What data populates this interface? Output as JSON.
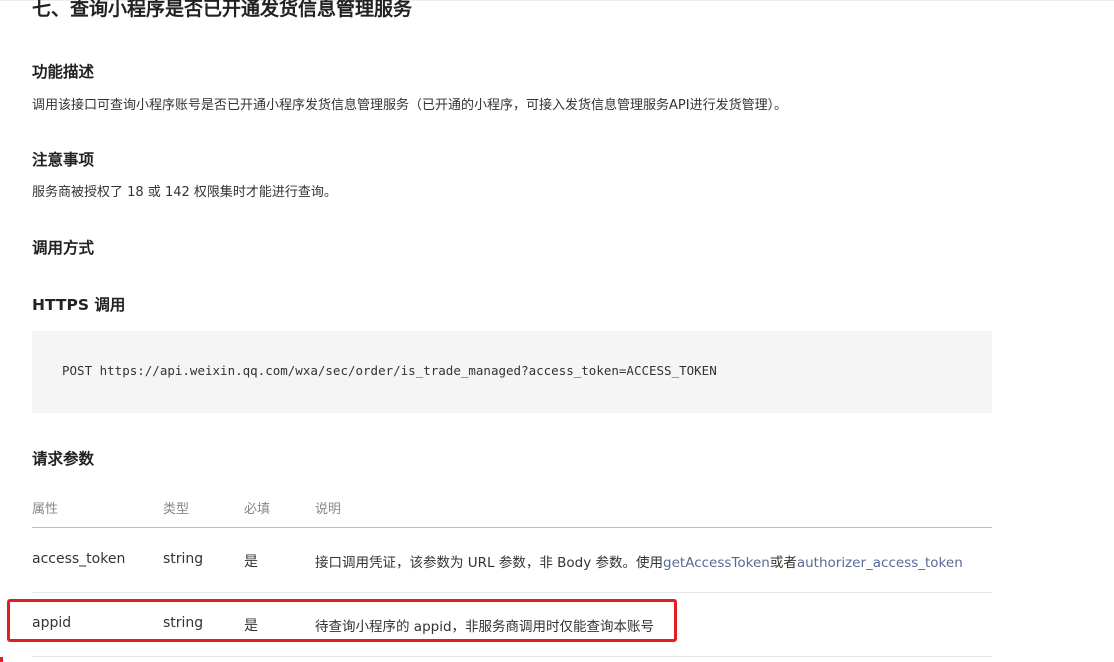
{
  "section_title": "七、查询小程序是否已开通发货信息管理服务",
  "function_desc": {
    "heading": "功能描述",
    "text": "调用该接口可查询小程序账号是否已开通小程序发货信息管理服务（已开通的小程序，可接入发货信息管理服务API进行发货管理）。"
  },
  "notes": {
    "heading": "注意事项",
    "text": "服务商被授权了 18 或 142 权限集时才能进行查询。"
  },
  "call_method": {
    "heading": "调用方式"
  },
  "https_call": {
    "heading": "HTTPS 调用",
    "code": "POST https://api.weixin.qq.com/wxa/sec/order/is_trade_managed?access_token=ACCESS_TOKEN"
  },
  "request_params": {
    "heading": "请求参数",
    "columns": [
      "属性",
      "类型",
      "必填",
      "说明"
    ],
    "rows": [
      {
        "name": "access_token",
        "type": "string",
        "required": "是",
        "desc_prefix": "接口调用凭证，该参数为 URL 参数，非 Body 参数。使用",
        "link1": "getAccessToken",
        "desc_mid": "或者",
        "link2": "authorizer_access_token"
      },
      {
        "name": "appid",
        "type": "string",
        "required": "是",
        "desc": "待查询小程序的 appid，非服务商调用时仅能查询本账号"
      }
    ]
  },
  "colors": {
    "highlight": "#e02020",
    "link": "#576b95",
    "code_bg": "#f5f5f5"
  }
}
